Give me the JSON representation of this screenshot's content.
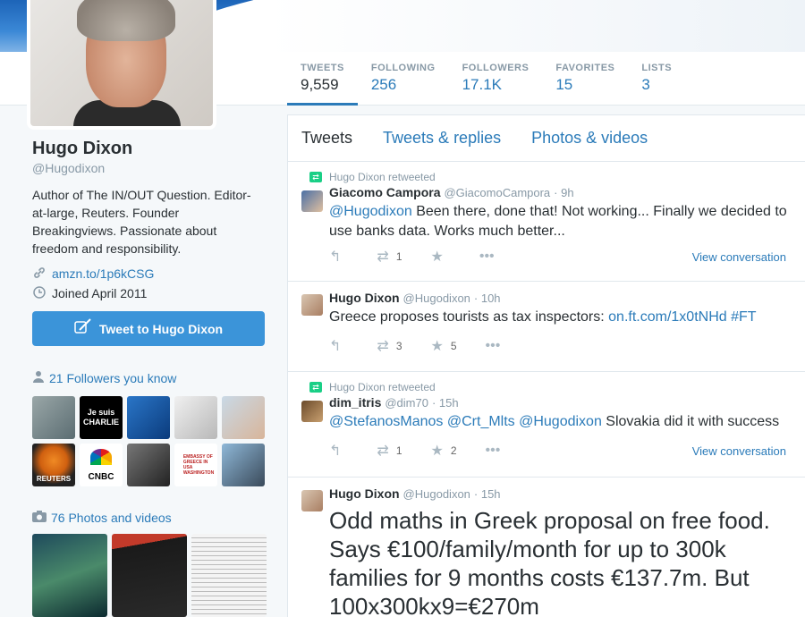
{
  "profile": {
    "name": "Hugo Dixon",
    "handle": "@Hugodixon",
    "bio": "Author of The IN/OUT Question. Editor-at-large, Reuters. Founder Breakingviews. Passionate about freedom and responsibility.",
    "link": "amzn.to/1p6kCSG",
    "joined": "Joined April 2011",
    "tweet_to_label": "Tweet to Hugo Dixon"
  },
  "stats": [
    {
      "label": "TWEETS",
      "value": "9,559",
      "active": true
    },
    {
      "label": "FOLLOWING",
      "value": "256"
    },
    {
      "label": "FOLLOWERS",
      "value": "17.1K"
    },
    {
      "label": "FAVORITES",
      "value": "15"
    },
    {
      "label": "LISTS",
      "value": "3"
    }
  ],
  "followers_you_know": {
    "title": "21 Followers you know",
    "tiles": [
      "",
      "Je suis CHARLIE",
      "",
      "",
      "",
      "REUTERS",
      "CNBC",
      "",
      "EMBASSY OF GREECE IN USA WASHINGTON",
      ""
    ]
  },
  "photos": {
    "title": "76 Photos and videos"
  },
  "tabs": [
    "Tweets",
    "Tweets & replies",
    "Photos & videos"
  ],
  "tweets": [
    {
      "retweeted_by": "Hugo Dixon retweeted",
      "name": "Giacomo Campora",
      "screen_name": "@GiacomoCampora",
      "time": "· 9h",
      "mention": "@Hugodixon",
      "text": " Been there, done that! Not working... Finally we decided to use banks data. Works much better...",
      "retweets": "1",
      "favorites": "",
      "view_conversation": "View conversation"
    },
    {
      "name": "Hugo Dixon",
      "screen_name": "@Hugodixon",
      "time": "· 10h",
      "text": "Greece proposes tourists as tax inspectors: ",
      "link": "on.ft.com/1x0tNHd",
      "hashtag": " #FT",
      "retweets": "3",
      "favorites": "5"
    },
    {
      "retweeted_by": "Hugo Dixon retweeted",
      "name": "dim_itris",
      "screen_name": "@dim70",
      "time": "· 15h",
      "mentions": "@StefanosManos @Crt_Mlts @Hugodixon",
      "text": " Slovakia did it with success",
      "retweets": "1",
      "favorites": "2",
      "view_conversation": "View conversation"
    },
    {
      "name": "Hugo Dixon",
      "screen_name": "@Hugodixon",
      "time": "· 15h",
      "text": "Odd maths in Greek proposal on free food. Says €100/family/month for up to 300k families for 9 months costs €137.7m. But 100x300kx9=€270m"
    }
  ],
  "colors": {
    "accent": "#2b7bb9",
    "button": "#3b94d9",
    "retweet_green": "#19cf86"
  },
  "icons": {
    "link": "link-icon",
    "calendar": "calendar-icon",
    "pen": "quill-icon",
    "person": "person-icon",
    "camera": "camera-icon",
    "reply": "reply-icon",
    "retweet": "retweet-icon",
    "favorite": "star-icon",
    "more": "more-icon"
  }
}
